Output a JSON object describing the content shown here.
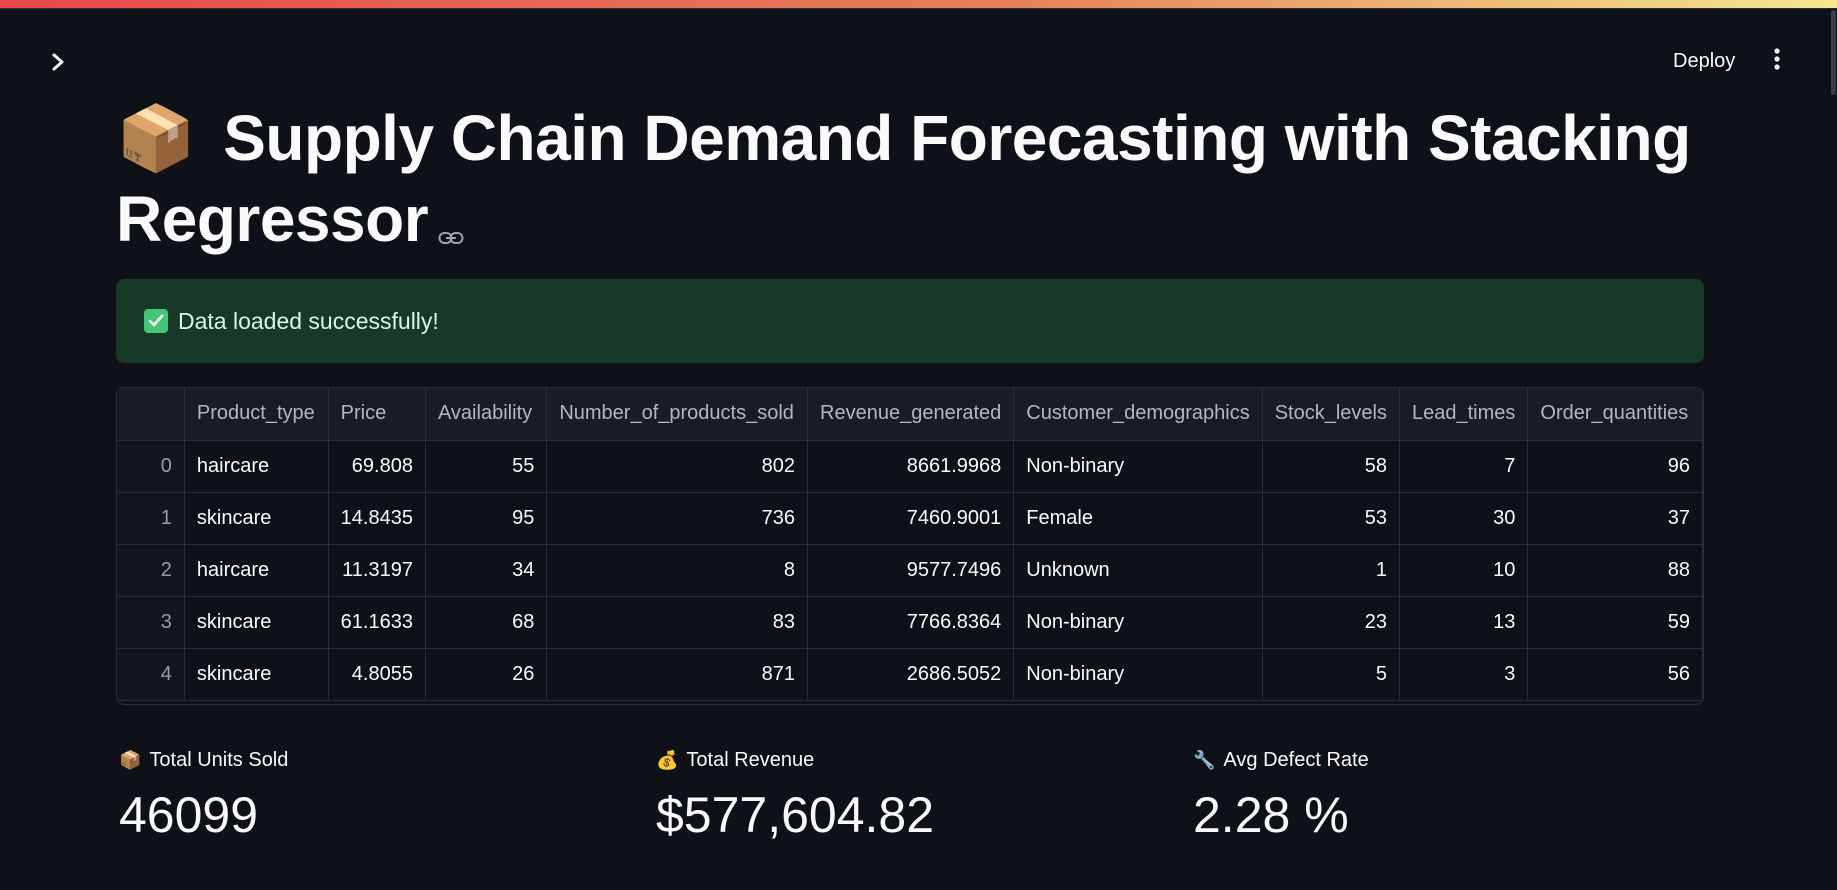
{
  "header": {
    "deploy_label": "Deploy"
  },
  "title": {
    "emoji": "📦",
    "text": "Supply Chain Demand Forecasting with Stacking Regressor"
  },
  "alert": {
    "message": "Data loaded successfully!"
  },
  "table": {
    "columns": [
      "Product_type",
      "Price",
      "Availability",
      "Number_of_products_sold",
      "Revenue_generated",
      "Customer_demographics",
      "Stock_levels",
      "Lead_times",
      "Order_quantities"
    ],
    "rows": [
      {
        "index": "0",
        "cells": [
          "haircare",
          "69.808",
          "55",
          "802",
          "8661.9968",
          "Non-binary",
          "58",
          "7",
          "96"
        ]
      },
      {
        "index": "1",
        "cells": [
          "skincare",
          "14.8435",
          "95",
          "736",
          "7460.9001",
          "Female",
          "53",
          "30",
          "37"
        ]
      },
      {
        "index": "2",
        "cells": [
          "haircare",
          "11.3197",
          "34",
          "8",
          "9577.7496",
          "Unknown",
          "1",
          "10",
          "88"
        ]
      },
      {
        "index": "3",
        "cells": [
          "skincare",
          "61.1633",
          "68",
          "83",
          "7766.8364",
          "Non-binary",
          "23",
          "13",
          "59"
        ]
      },
      {
        "index": "4",
        "cells": [
          "skincare",
          "4.8055",
          "26",
          "871",
          "2686.5052",
          "Non-binary",
          "5",
          "3",
          "56"
        ]
      }
    ]
  },
  "metrics": [
    {
      "icon": "📦",
      "label": "Total Units Sold",
      "value": "46099"
    },
    {
      "icon": "💰",
      "label": "Total Revenue",
      "value": "$577,604.82"
    },
    {
      "icon": "🔧",
      "label": "Avg Defect Rate",
      "value": "2.28 %"
    }
  ]
}
